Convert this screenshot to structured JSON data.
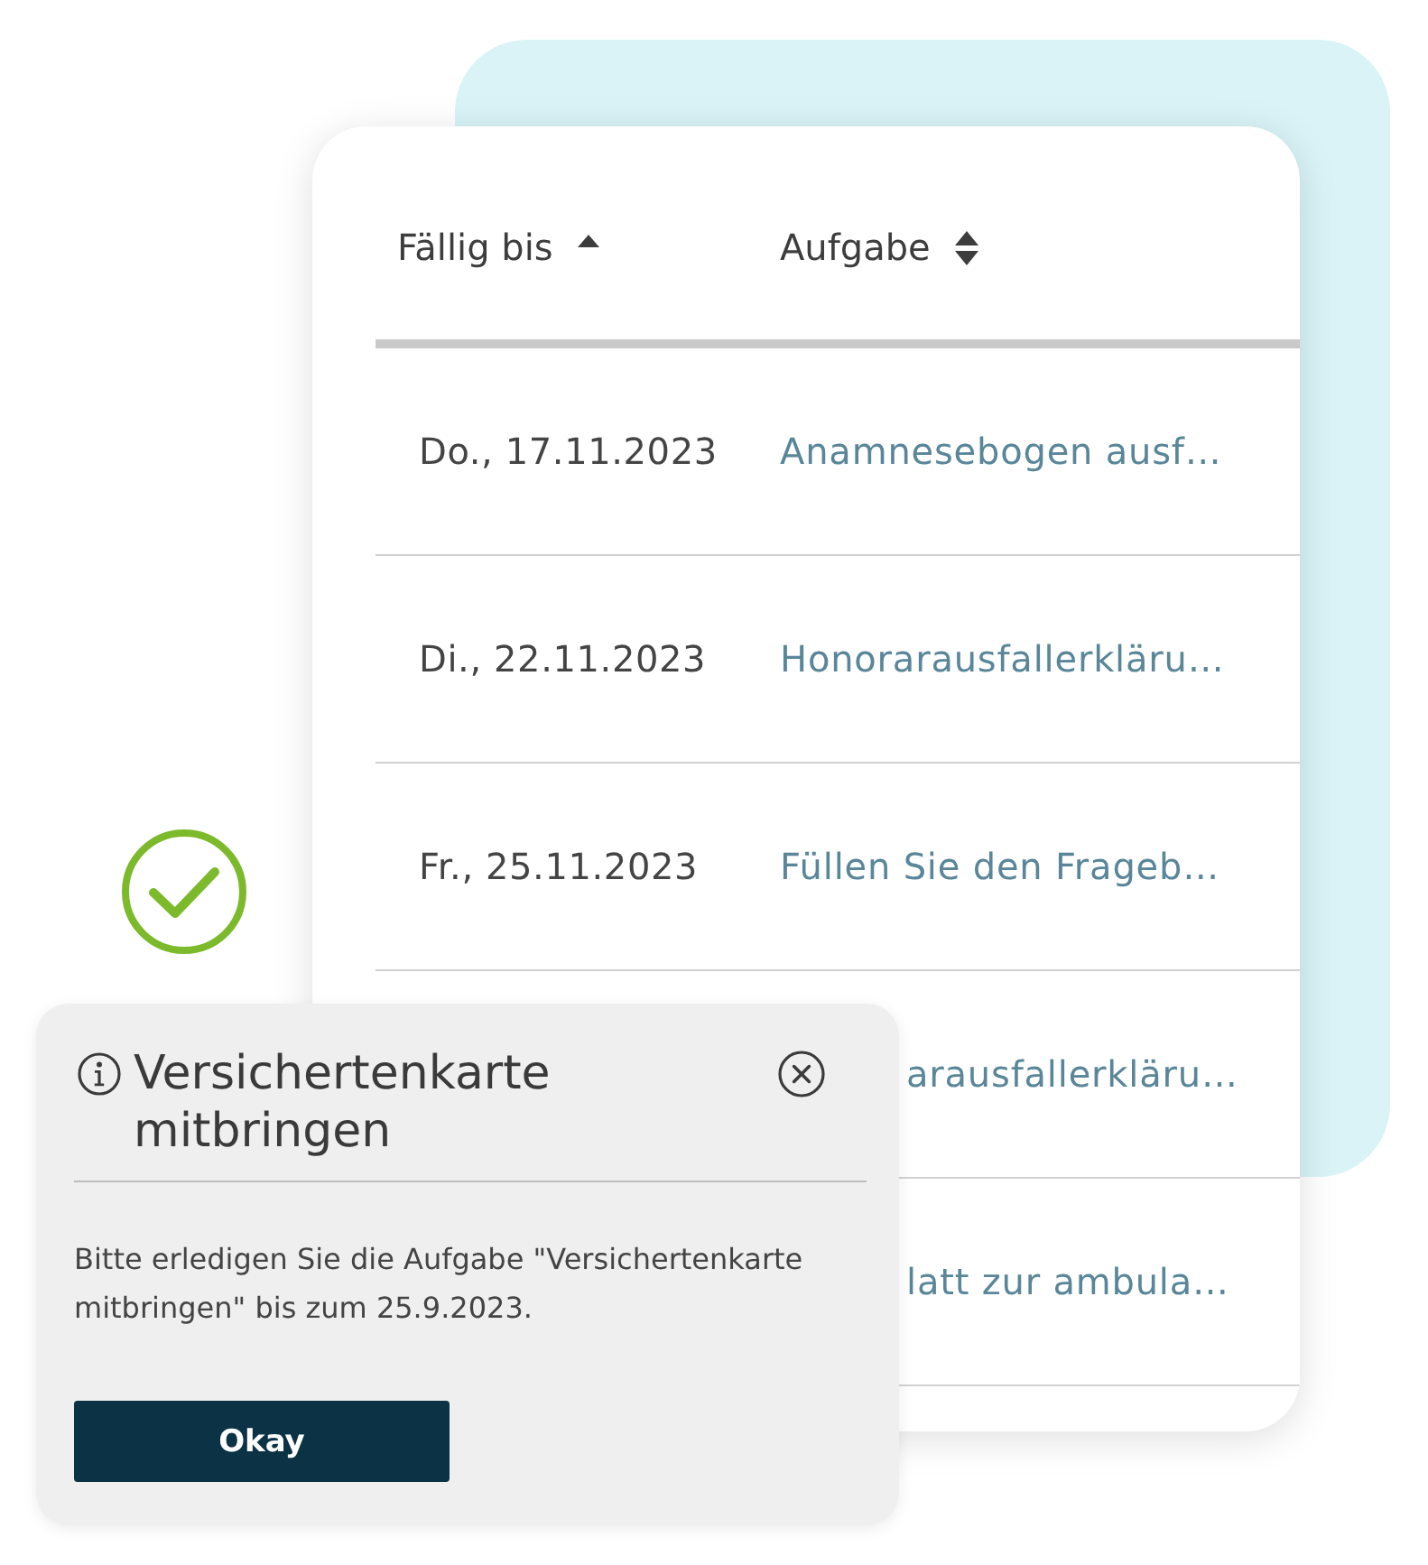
{
  "table": {
    "columns": [
      {
        "label": "Fällig bis",
        "sorted": true
      },
      {
        "label": "Aufgabe",
        "sorted": false
      }
    ],
    "rows": [
      {
        "kind": "full",
        "date": "Do., 17.11.2023",
        "task": "Anamnesebogen ausf…"
      },
      {
        "kind": "full",
        "date": "Di., 22.11.2023",
        "task": "Honorarausfallerkläru…"
      },
      {
        "kind": "full",
        "date": "Fr., 25.11.2023",
        "task": "Füllen Sie den Frageb…"
      },
      {
        "kind": "covered",
        "task": "arausfallerkläru…"
      },
      {
        "kind": "covered",
        "task": "latt zur ambula…"
      }
    ]
  },
  "dialog": {
    "title": "Versichertenkarte mitbringen",
    "message": "Bitte erledigen Sie die Aufgabe \"Versichertenkarte mitbringen\" bis zum 25.9.2023.",
    "button": "Okay"
  }
}
